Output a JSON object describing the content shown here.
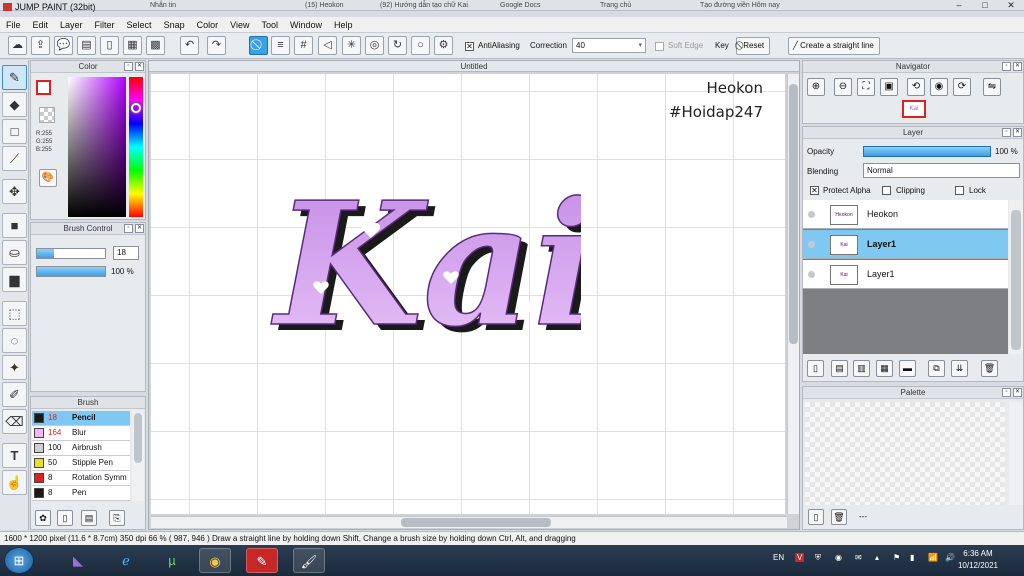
{
  "browser_tabs": [
    "Nhắn tin",
    "(15) Heokon",
    "(92) Hướng dẫn tạo chữ Kai",
    "Google Docs",
    "Trang chủ",
    "Tạo đường viền Hôm nay"
  ],
  "app": {
    "title": "JUMP PAINT (32bit)",
    "menu": [
      "File",
      "Edit",
      "Layer",
      "Filter",
      "Select",
      "Snap",
      "Color",
      "View",
      "Tool",
      "Window",
      "Help"
    ]
  },
  "toolbar": {
    "antialiasing_label": "AntiAliasing",
    "antialiasing_checked": true,
    "correction_label": "Correction",
    "correction_value": "40",
    "soft_edge_label": "Soft Edge",
    "key_label": "Key",
    "reset_label": "Reset",
    "straight_line_label": "Create a straight line"
  },
  "color_panel": {
    "title": "Color",
    "r": "R:255",
    "g": "G:255",
    "b": "B:255",
    "fg_color": "#ffffff",
    "accent": "#e02020"
  },
  "brush_control": {
    "title": "Brush Control",
    "size_value": "18",
    "size_fraction": 0.25,
    "opacity_value": "100 %",
    "opacity_fraction": 1.0
  },
  "brush_panel": {
    "title": "Brush",
    "items": [
      {
        "size": "18",
        "name": "Pencil",
        "color": "#1a1a1a",
        "selected": true
      },
      {
        "size": "164",
        "name": "Blur",
        "color": "#f4b8f0",
        "selected": false
      },
      {
        "size": "100",
        "name": "Airbrush",
        "color": "#d0d0d0",
        "selected": false
      },
      {
        "size": "50",
        "name": "Stipple Pen",
        "color": "#e8e020",
        "selected": false
      },
      {
        "size": "8",
        "name": "Rotation Symm",
        "color": "#e02020",
        "selected": false
      },
      {
        "size": "8",
        "name": "Pen",
        "color": "#1a1a1a",
        "selected": false
      }
    ]
  },
  "canvas": {
    "tab_title": "Untitled",
    "watermark_line1": "Heokon",
    "watermark_line2": "#Hoidap247",
    "artwork_text": "Kai",
    "artwork_color": "#c48ae6",
    "artwork_shadow": "#1a1a1a"
  },
  "navigator": {
    "title": "Navigator"
  },
  "layer_panel": {
    "title": "Layer",
    "opacity_label": "Opacity",
    "opacity_value": "100 %",
    "blending_label": "Blending",
    "blending_value": "Normal",
    "protect_alpha_label": "Protect Alpha",
    "protect_alpha_checked": true,
    "clipping_label": "Clipping",
    "lock_label": "Lock",
    "layers": [
      {
        "name": "Heokon",
        "thumb": "Heokon #Hoidap247",
        "selected": false
      },
      {
        "name": "Layer1",
        "thumb": "Kai",
        "selected": true
      },
      {
        "name": "Layer1",
        "thumb": "Kai",
        "selected": false
      }
    ]
  },
  "palette": {
    "title": "Palette",
    "footer": "---"
  },
  "status": {
    "text": "1600 * 1200 pixel  (11.6 * 8.7cm)  350 dpi  66 %  ( 987, 946 )  Draw a straight line by holding down Shift, Change a brush size by holding down Ctrl, Alt, and dragging"
  },
  "taskbar": {
    "lang": "EN",
    "time": "6:36 AM",
    "date": "10/12/2021",
    "apps": [
      "visual-studio-icon",
      "internet-explorer-icon",
      "utorrent-icon",
      "chrome-icon",
      "jumppaint-icon",
      "paint-brush-icon"
    ]
  }
}
